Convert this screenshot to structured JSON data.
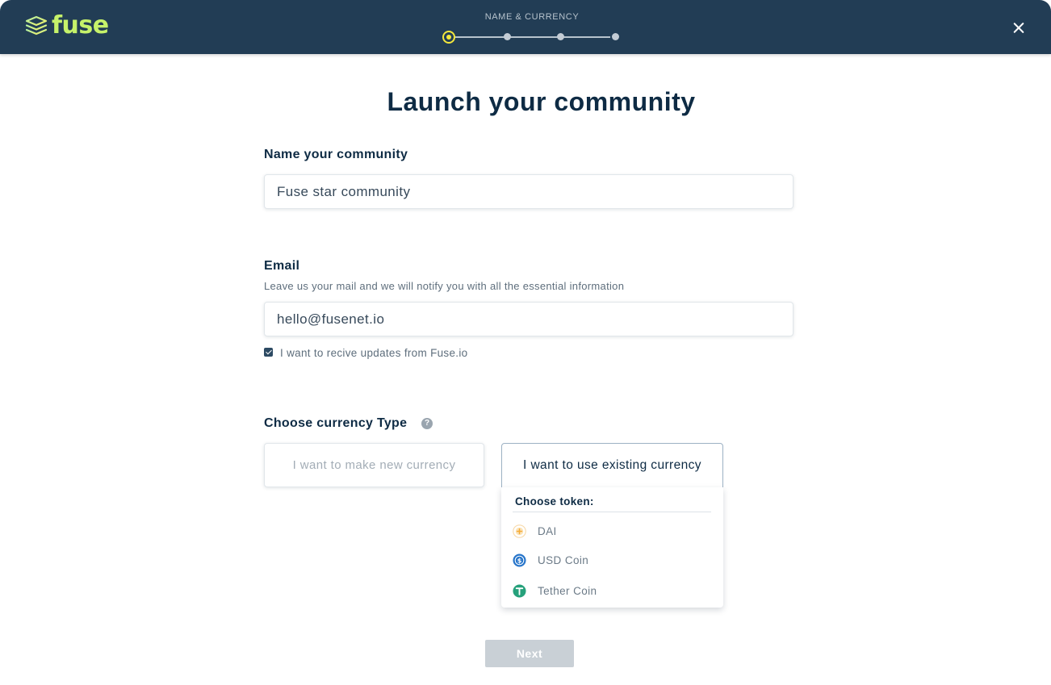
{
  "header": {
    "logo_text": "fuse",
    "step_title": "NAME & CURRENCY",
    "steps_total": 4,
    "current_step": 1,
    "accent_color": "#f4e83c",
    "logo_color": "#c6f26a",
    "background_color": "#223d55",
    "close_icon": "close-icon"
  },
  "main": {
    "title": "Launch your community",
    "name_field": {
      "label": "Name your community",
      "value": "Fuse star community"
    },
    "email_field": {
      "label": "Email",
      "description": "Leave us your mail and we will notify you with all the essential information",
      "value": "hello@fusenet.io"
    },
    "updates_checkbox": {
      "label": "I want to recive updates from Fuse.io",
      "checked": true
    },
    "currency": {
      "label": "Choose currency Type",
      "help_icon": "?",
      "option_new": "I want to make new currency",
      "option_existing": "I want to use existing currency",
      "selected": "existing"
    },
    "token_dropdown": {
      "title": "Choose token:",
      "tokens": [
        {
          "label": "DAI",
          "icon": "dai-icon",
          "color": "#f5ac37"
        },
        {
          "label": "USD Coin",
          "icon": "usdc-icon",
          "color": "#2775ca"
        },
        {
          "label": "Tether Coin",
          "icon": "tether-icon",
          "color": "#26a17b"
        }
      ]
    },
    "next_button": "Next"
  }
}
